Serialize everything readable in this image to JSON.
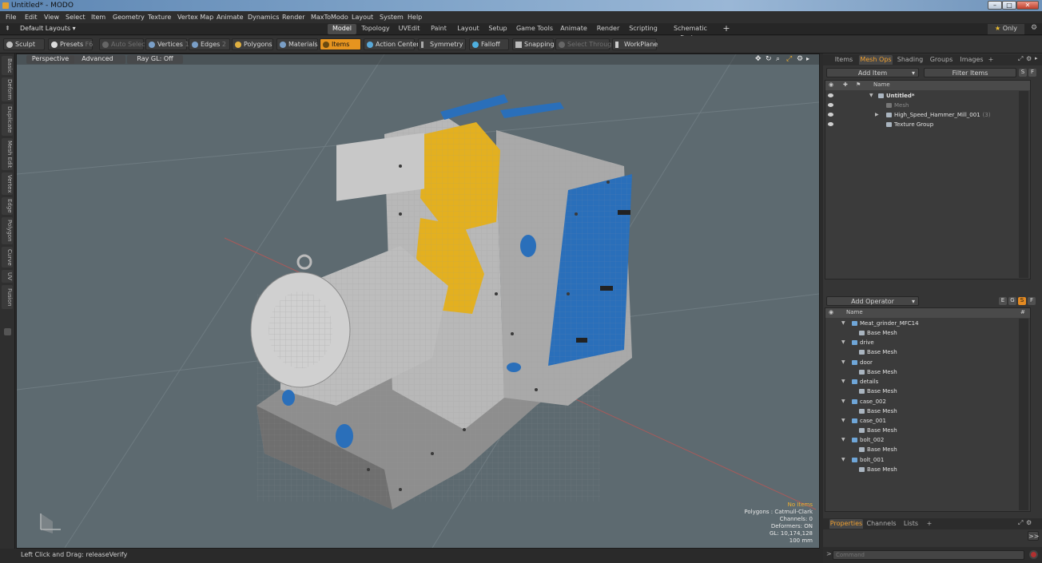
{
  "window": {
    "title": "Untitled* - MODO"
  },
  "menu": [
    "File",
    "Edit",
    "View",
    "Select",
    "Item",
    "Geometry",
    "Texture",
    "Vertex Map",
    "Animate",
    "Dynamics",
    "Render",
    "MaxToModo",
    "Layout",
    "System",
    "Help"
  ],
  "layout": {
    "dropdown": "Default Layouts ▾",
    "tabs": [
      "Model",
      "Topology",
      "UVEdit",
      "Paint",
      "Layout",
      "Setup",
      "Game Tools",
      "Animate",
      "Render",
      "Scripting",
      "Schematic Fusion"
    ],
    "active_tab": "Model",
    "add": "+",
    "only": "Only"
  },
  "toolbar": {
    "sculpt": "Sculpt",
    "presets": "Presets",
    "presets_key": "F6",
    "auto_select": "Auto Select",
    "vertices": "Vertices",
    "vertices_key": "1",
    "edges": "Edges",
    "edges_key": "2",
    "polygons": "Polygons",
    "materials": "Materials",
    "items": "Items",
    "action_center": "Action Center",
    "symmetry": "Symmetry",
    "falloff": "Falloff",
    "snapping": "Snapping",
    "select_through": "Select Through",
    "workplane": "WorkPlane"
  },
  "left_tabs": [
    "Basic",
    "Deform",
    "Duplicate",
    "Mesh Edit",
    "Vertex",
    "Edge",
    "Polygon",
    "Curve",
    "UV",
    "Fusion"
  ],
  "viewport": {
    "perspective": "Perspective",
    "advanced": "Advanced",
    "raygl": "Ray GL: Off",
    "info": {
      "no_items": "No Items",
      "polygons": "Polygons : Catmull-Clark",
      "channels": "Channels: 0",
      "deformers": "Deformers: ON",
      "gl": "GL: 10,174,128",
      "scale": "100 mm"
    }
  },
  "status": {
    "text": "Left Click and Drag:  releaseVerify"
  },
  "items_panel": {
    "tabs": [
      "Items",
      "Mesh Ops",
      "Shading",
      "Groups",
      "Images"
    ],
    "active_tab": "Mesh Ops",
    "add_item": "Add Item",
    "filter": "Filter Items",
    "s": "S",
    "f": "F",
    "name_header": "Name",
    "rows": [
      {
        "label": "Untitled*",
        "count": ""
      },
      {
        "label": "Mesh",
        "count": ""
      },
      {
        "label": "High_Speed_Hammer_Mill_001",
        "count": "(3)"
      },
      {
        "label": "Texture Group",
        "count": ""
      }
    ]
  },
  "meshops_panel": {
    "add_operator": "Add Operator",
    "e": "E",
    "g": "G",
    "s": "S",
    "f": "F",
    "name_header": "Name",
    "hash": "#",
    "groups": [
      {
        "name": "Meat_grinder_MFC14",
        "child": "Base Mesh"
      },
      {
        "name": "drive",
        "child": "Base Mesh"
      },
      {
        "name": "door",
        "child": "Base Mesh"
      },
      {
        "name": "details",
        "child": "Base Mesh"
      },
      {
        "name": "case_002",
        "child": "Base Mesh"
      },
      {
        "name": "case_001",
        "child": "Base Mesh"
      },
      {
        "name": "bolt_002",
        "child": "Base Mesh"
      },
      {
        "name": "bolt_001",
        "child": "Base Mesh"
      }
    ]
  },
  "props_panel": {
    "tabs": [
      "Properties",
      "Channels",
      "Lists"
    ],
    "active_tab": "Properties",
    "add": "+",
    "expand": ">>",
    "command_placeholder": "Command"
  },
  "colors": {
    "accent": "#e6941f",
    "viewport_bg": "#5d6a70",
    "mesh_yellow": "#e3b020",
    "mesh_blue": "#2a6fba"
  }
}
